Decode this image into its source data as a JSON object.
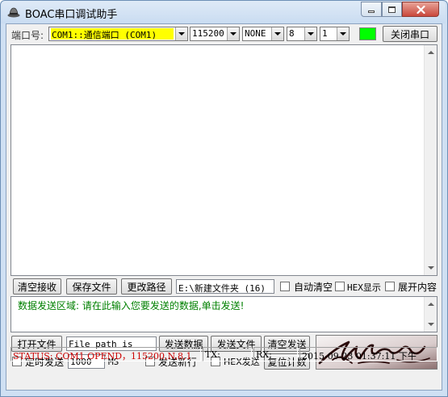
{
  "window": {
    "title": "BOAC串口调试助手",
    "app_icon": "hat-icon"
  },
  "toolbar": {
    "port_label": "端口号:",
    "port_value": "COM1::通信端口 (COM1)",
    "baud_value": "115200",
    "parity_value": "NONE",
    "databits_value": "8",
    "stopbits_value": "1",
    "close_port_label": "关闭串口",
    "port_status_color": "#00ff00",
    "port_value_bg": "#ffff00"
  },
  "receive": {
    "clear_label": "清空接收",
    "save_label": "保存文件",
    "change_path_label": "更改路径",
    "path_value": "E:\\新建文件夹 (16)",
    "auto_clear_label": "自动清空",
    "hex_display_label": "HEX显示",
    "expand_label": "展开内容"
  },
  "send": {
    "hint_text": "数据发送区域: 请在此输入您要发送的数据,单击发送!",
    "hint_color": "#008000",
    "open_file_label": "打开文件",
    "file_path_value": "File path is",
    "send_data_label": "发送数据",
    "send_file_label": "发送文件",
    "clear_send_label": "清空发送",
    "timed_send_label": "定时发送",
    "interval_value": "1000",
    "interval_unit": "MS",
    "send_newline_label": "发送新行",
    "hex_send_label": "HEX发送",
    "reset_count_label": "复位计数"
  },
  "status": {
    "status_text": "STATUS: COM1 OPEND，115200,N,8,1",
    "status_color": "#cc0000",
    "tx_label": "TX:",
    "rx_label": "RX:",
    "datetime": "2015-09-23  01:37:11 下午"
  }
}
